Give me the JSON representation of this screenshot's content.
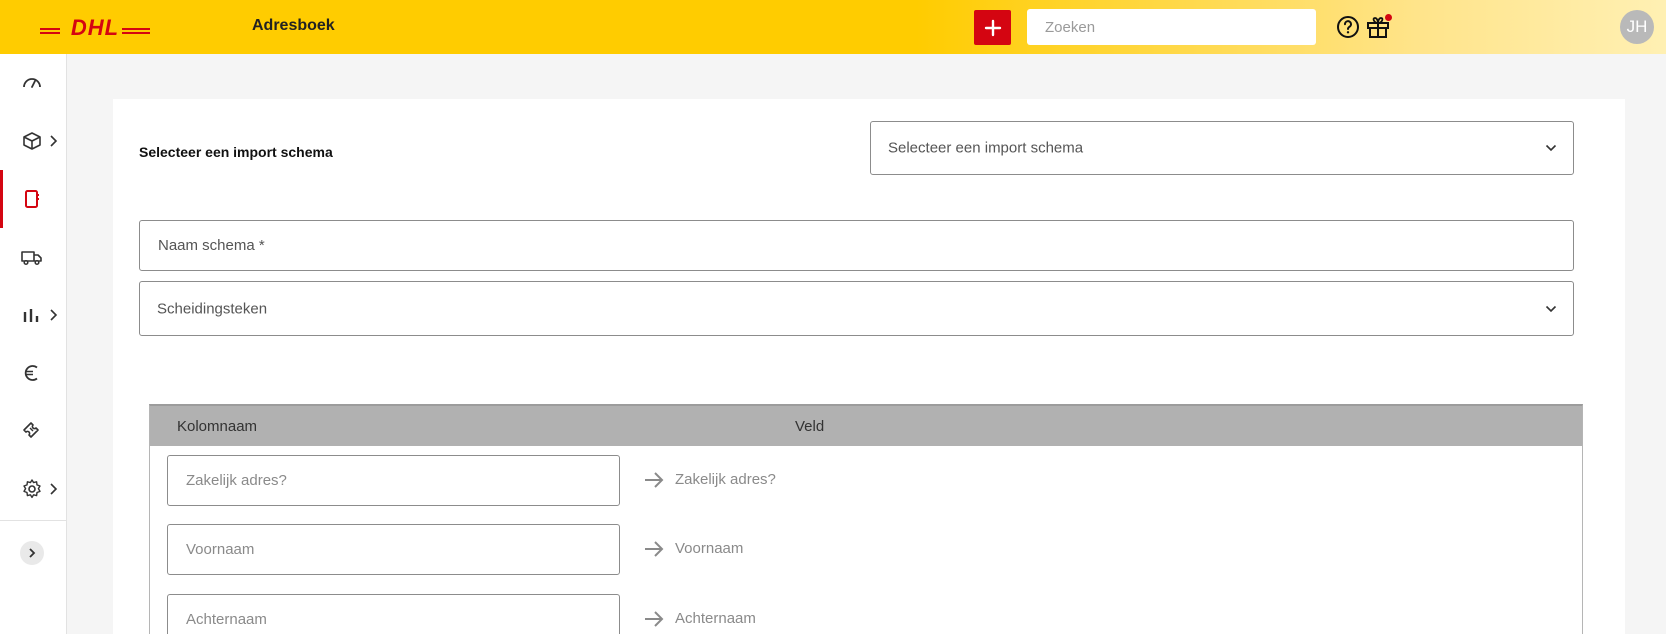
{
  "header": {
    "logo_text": "DHL",
    "title": "Adresboek",
    "add_icon": "plus-icon",
    "search_placeholder": "Zoeken",
    "help_icon": "help-icon",
    "gift_icon": "gift-icon",
    "avatar_initials": "JH",
    "colors": {
      "brand_yellow": "#ffcc00",
      "brand_red": "#d40511"
    }
  },
  "sidebar": {
    "items": [
      {
        "icon": "dashboard-icon",
        "has_submenu": false,
        "active": false
      },
      {
        "icon": "package-icon",
        "has_submenu": true,
        "active": false
      },
      {
        "icon": "address-book-icon",
        "has_submenu": false,
        "active": true
      },
      {
        "icon": "truck-icon",
        "has_submenu": false,
        "active": false
      },
      {
        "icon": "bar-chart-icon",
        "has_submenu": true,
        "active": false
      },
      {
        "icon": "euro-icon",
        "has_submenu": false,
        "active": false
      },
      {
        "icon": "ticket-icon",
        "has_submenu": false,
        "active": false
      },
      {
        "icon": "settings-icon",
        "has_submenu": true,
        "active": false
      }
    ],
    "collapse_icon": "chevron-right-icon"
  },
  "form": {
    "import_label": "Selecteer een import schema",
    "import_select_value": "Selecteer een import schema",
    "name_placeholder": "Naam schema *",
    "separator_select_value": "Scheidingsteken"
  },
  "mapping": {
    "headers": {
      "column_name": "Kolomnaam",
      "field": "Veld"
    },
    "rows": [
      {
        "column_placeholder": "Zakelijk adres?",
        "field": "Zakelijk adres?"
      },
      {
        "column_placeholder": "Voornaam",
        "field": "Voornaam"
      },
      {
        "column_placeholder": "Achternaam",
        "field": "Achternaam"
      }
    ]
  }
}
